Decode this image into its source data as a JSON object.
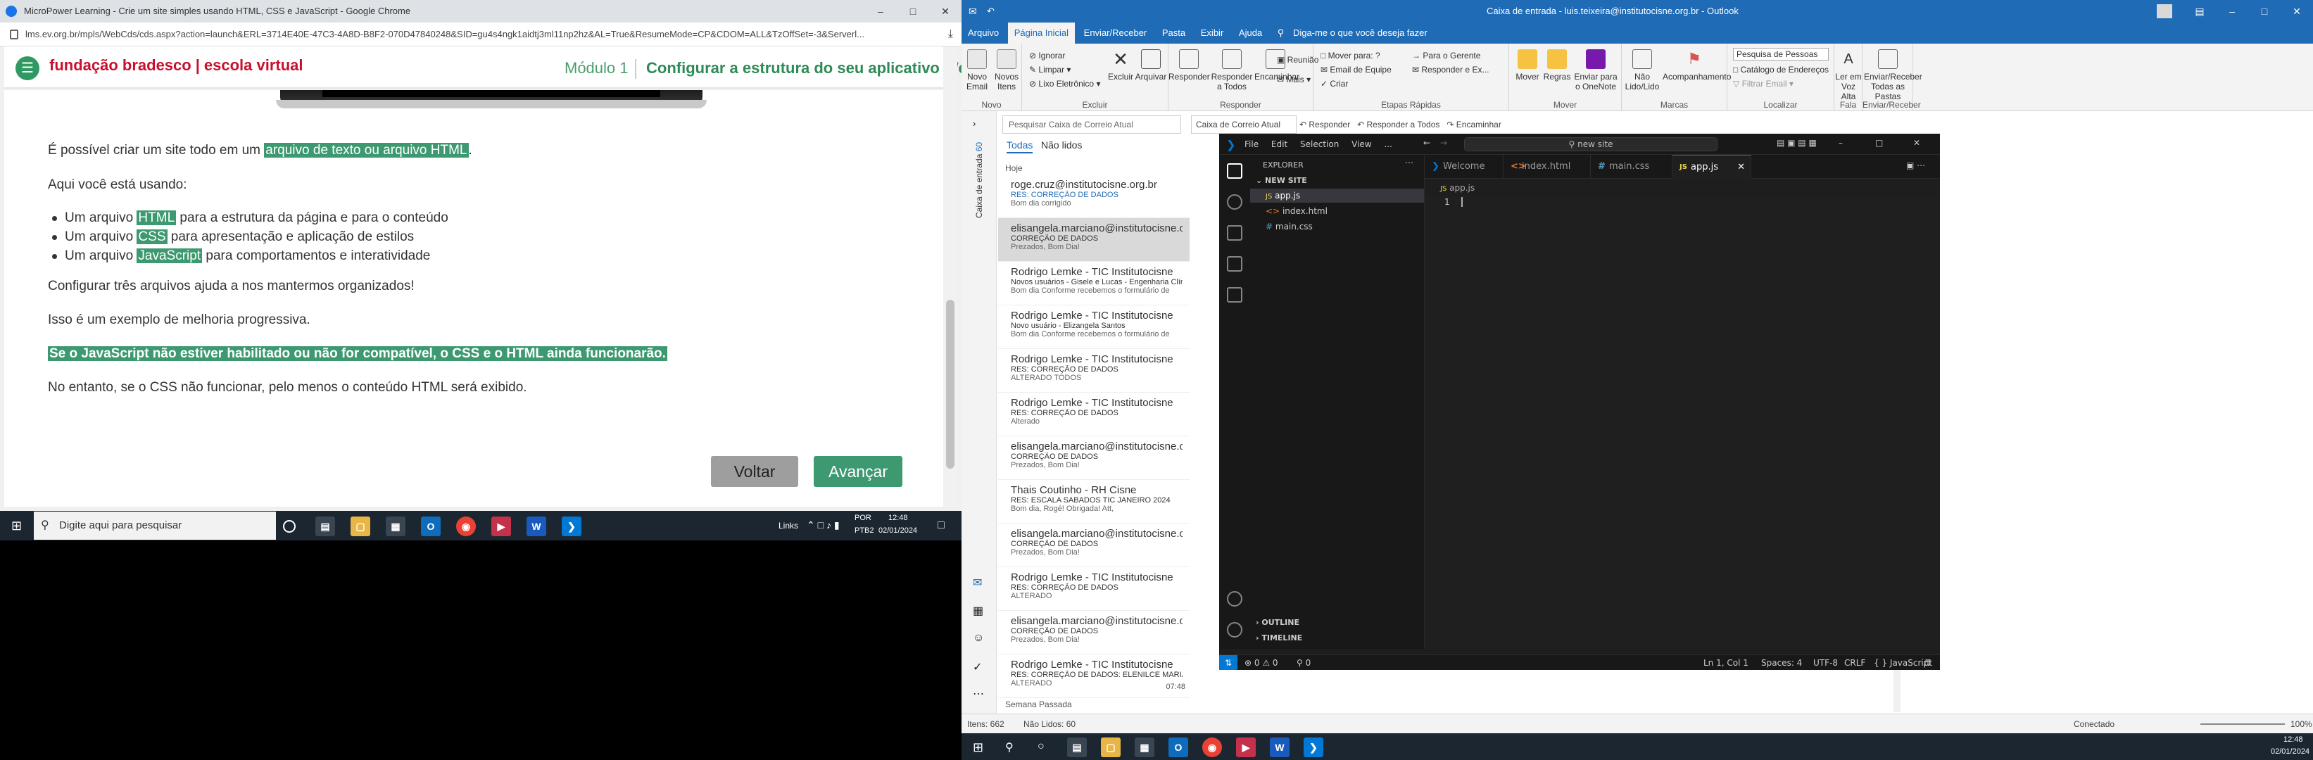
{
  "chrome": {
    "title": "MicroPower Learning - Crie um site simples usando HTML, CSS e JavaScript - Google Chrome",
    "url": "lms.ev.org.br/mpls/WebCds/cds.aspx?action=launch&ERL=3714E40E-47C3-4A8D-B8F2-070D47840248&SID=gu4s4ngk1aidtj3ml11np2hz&AL=True&ResumeMode=CP&CDOM=ALL&TzOffSet=-3&Serverl..."
  },
  "site": {
    "logo_brand": "fundação bradesco",
    "logo_school": "escola virtual",
    "module_label": "Módulo 1",
    "module_title": "Configurar a estrutura do seu aplicativo Web",
    "p1_pre": "É possível criar um site todo em um ",
    "p1_hl": "arquivo de texto ou arquivo HTML",
    "p1_post": ".",
    "p2": "Aqui você está usando:",
    "b1_pre": "Um arquivo ",
    "b1_hl": "HTML",
    "b1_post": " para a estrutura da página e para o conteúdo",
    "b2_pre": "Um arquivo ",
    "b2_hl": "CSS",
    "b2_post": " para apresentação e aplicação de estilos",
    "b3_pre": "Um arquivo ",
    "b3_hl": "JavaScript",
    "b3_post": " para comportamentos e interatividade",
    "p3": "Configurar três arquivos ajuda a nos mantermos organizados!",
    "p4": "Isso é um exemplo de melhoria progressiva.",
    "p5": "Se o JavaScript não estiver habilitado ou não for compatível, o CSS e o HTML ainda funcionarão.",
    "p6": "No entanto, se o CSS não funcionar, pelo menos o conteúdo HTML será exibido.",
    "back_label": "Voltar",
    "next_label": "Avançar"
  },
  "taskbar_left": {
    "search_placeholder": "Digite aqui para pesquisar",
    "links": "Links",
    "lang1": "POR",
    "lang2": "PTB2",
    "time": "12:48",
    "date": "02/01/2024"
  },
  "outlook": {
    "title": "Caixa de entrada - luis.teixeira@institutocisne.org.br - Outlook",
    "tabs": [
      "Arquivo",
      "Página Inicial",
      "Enviar/Receber",
      "Pasta",
      "Exibir",
      "Ajuda"
    ],
    "tell_me": "Diga-me o que você deseja fazer",
    "ribbon": {
      "novo_email": "Novo Email",
      "novos_itens": "Novos Itens",
      "grp_novo": "Novo",
      "ignorar": "Ignorar",
      "limpar": "Limpar",
      "lixo": "Lixo Eletrônico",
      "excluir": "Excluir",
      "arquivar": "Arquivar",
      "grp_excluir": "Excluir",
      "responder": "Responder",
      "responder_todos": "Responder a Todos",
      "encaminhar": "Encaminhar",
      "reuniao": "Reunião",
      "mais": "Mais",
      "grp_responder": "Responder",
      "mover_para": "Mover para: ?",
      "email_equipe": "Email de Equipe",
      "criar": "Criar",
      "para_gerente": "Para o Gerente",
      "responder_ex": "Responder e Ex...",
      "grp_etapas": "Etapas Rápidas",
      "mover": "Mover",
      "regras": "Regras",
      "onenote": "Enviar para o OneNote",
      "grp_mover": "Mover",
      "nao_lido": "Não Lido/Lido",
      "acompanhamento": "Acompanhamento",
      "grp_marcas": "Marcas",
      "pesquisa_pessoas": "Pesquisa de Pessoas",
      "catalogo": "Catálogo de Endereços",
      "filtrar": "Filtrar Email",
      "grp_localizar": "Localizar",
      "ler_voz": "Ler em Voz Alta",
      "grp_fala": "Fala",
      "enviar_receber": "Enviar/Receber Todas as Pastas",
      "grp_enviar": "Enviar/Receber"
    },
    "search_placeholder": "Pesquisar Caixa de Correio Atual",
    "scope": "Caixa de Correio Atual",
    "reply_bar": [
      "Responder",
      "Responder a Todos",
      "Encaminhar"
    ],
    "folder_label": "Caixa de entrada",
    "folder_count": "60",
    "filter_all": "Todas",
    "filter_unread": "Não lidos",
    "group_today": "Hoje",
    "group_last_week": "Semana Passada",
    "messages": [
      {
        "from": "roge.cruz@institutocisne.org.br",
        "subject": "RES: CORREÇÃO DE DADOS",
        "preview": "Bom dia  corrigido",
        "time": "",
        "unread": true
      },
      {
        "from": "elisangela.marciano@institutocisne.org...",
        "subject": "CORREÇÃO DE DADOS",
        "preview": "Prezados, Bom Dia!",
        "time": "",
        "unread": false
      },
      {
        "from": "Rodrigo Lemke - TIC Institutocisne",
        "subject": "Novos usuários  - Gisele e Lucas  - Engenharia Clínica",
        "preview": "Bom dia  Conforme recebemos o formulário de",
        "time": "",
        "unread": false
      },
      {
        "from": "Rodrigo Lemke - TIC Institutocisne",
        "subject": "Novo usuário  - Elizangela Santos",
        "preview": "Bom dia  Conforme recebemos o formulário de",
        "time": "",
        "unread": false
      },
      {
        "from": "Rodrigo Lemke - TIC Institutocisne",
        "subject": "RES: CORREÇÃO DE DADOS",
        "preview": "ALTERADO TODOS",
        "time": "",
        "unread": false
      },
      {
        "from": "Rodrigo Lemke - TIC Institutocisne",
        "subject": "RES: CORREÇÃO DE DADOS",
        "preview": "Alterado",
        "time": "",
        "unread": false
      },
      {
        "from": "elisangela.marciano@institutocisne.org...",
        "subject": "CORREÇÃO DE DADOS",
        "preview": "Prezados, Bom Dia!",
        "time": "",
        "unread": false
      },
      {
        "from": "Thais Coutinho - RH Cisne",
        "subject": "RES: ESCALA SABADOS TIC JANEIRO 2024",
        "preview": "Bom dia, Rogé!  Obrigada!  Att,",
        "time": "",
        "unread": false
      },
      {
        "from": "elisangela.marciano@institutocisne.org...",
        "subject": "CORREÇÃO DE DADOS",
        "preview": "Prezados, Bom Dia!",
        "time": "",
        "unread": false
      },
      {
        "from": "Rodrigo Lemke - TIC Institutocisne",
        "subject": "RES: CORREÇÃO DE DADOS",
        "preview": "ALTERADO",
        "time": "",
        "unread": false
      },
      {
        "from": "elisangela.marciano@institutocisne.org...",
        "subject": "CORREÇÃO DE DADOS",
        "preview": "Prezados, Bom Dia!",
        "time": "",
        "unread": false
      },
      {
        "from": "Rodrigo Lemke - TIC Institutocisne",
        "subject": "RES: CORREÇÃO DE DADOS: ELENILCE MARIA PISTILLI",
        "preview": "ALTERADO",
        "time": "07:48",
        "unread": false
      }
    ],
    "status_items": "Itens: 662",
    "status_unread": "Não Lidos: 60",
    "status_conn": "Conectado",
    "zoom": "100%"
  },
  "vscode": {
    "menu": [
      "File",
      "Edit",
      "Selection",
      "View",
      "..."
    ],
    "command_center": "new site",
    "explorer_title": "EXPLORER",
    "folder": "NEW SITE",
    "files": [
      "app.js",
      "index.html",
      "main.css"
    ],
    "tabs": [
      "Welcome",
      "index.html",
      "main.css",
      "app.js"
    ],
    "breadcrumb": "app.js",
    "line_number": "1",
    "outline": "OUTLINE",
    "timeline": "TIMELINE",
    "status_errors": "0",
    "status_warnings": "0",
    "status_ports": "0",
    "status_pos": "Ln 1, Col 1",
    "status_spaces": "Spaces: 4",
    "status_enc": "UTF-8",
    "status_eol": "CRLF",
    "status_lang": "JavaScript"
  },
  "taskbar_right": {
    "time": "12:48",
    "date": "02/01/2024"
  }
}
